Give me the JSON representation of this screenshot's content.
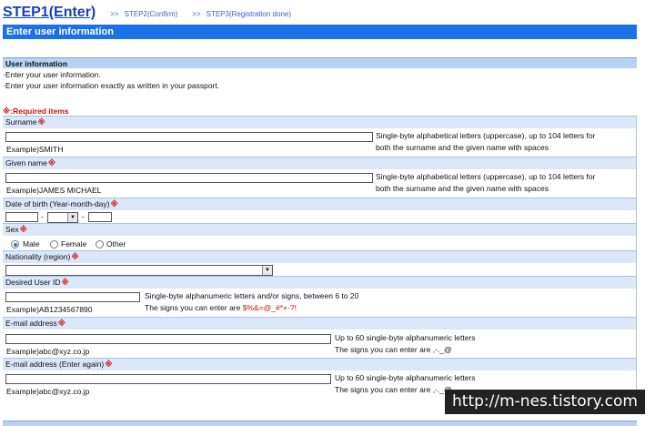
{
  "steps": {
    "step1": "STEP1(Enter)",
    "sep1": ">>",
    "step2": "STEP2(Confirm)",
    "sep2": ">>",
    "step3": "STEP3(Registration done)"
  },
  "header": {
    "title": "Enter user information"
  },
  "section": {
    "title": "User information",
    "notes": [
      "·Enter your user information.",
      "·Enter your user information exactly as written in your passport."
    ]
  },
  "required_label": "※:Required items",
  "required_mark": "※",
  "fields": {
    "surname": {
      "label": "Surname",
      "value": "",
      "example": "Example)SMITH",
      "hint1": "Single-byte alphabetical letters (uppercase), up to 104 letters for",
      "hint2": "both the surname and the given name with spaces"
    },
    "given_name": {
      "label": "Given name",
      "value": "",
      "example": "Example)JAMES MICHAEL",
      "hint1": "Single-byte alphabetical letters (uppercase), up to 104 letters for",
      "hint2": "both the surname and the given name with spaces"
    },
    "dob": {
      "label": "Date of birth (Year-month-day)",
      "year": "",
      "month": "",
      "day": "",
      "dash": "-"
    },
    "sex": {
      "label": "Sex",
      "options": [
        "Male",
        "Female",
        "Other"
      ],
      "selected": "Male"
    },
    "nationality": {
      "label": "Nationality (region)",
      "value": ""
    },
    "user_id": {
      "label": "Desired User ID",
      "value": "",
      "example": "Example)AB1234567890",
      "hint1": "Single-byte alphanumeric letters and/or signs, between 6 to 20",
      "hint2_prefix": "The signs you can enter are ",
      "hint2_signs": "$%&=@_#*+-?!"
    },
    "email": {
      "label": "E-mail address",
      "value": "",
      "example": "Example)abc@xyz.co.jp",
      "hint1": "Up to 60 single-byte alphanumeric letters",
      "hint2": "The signs you can enter are ,-._@"
    },
    "email2": {
      "label": "E-mail address (Enter again)",
      "value": "",
      "example": "Example)abc@xyz.co.jp",
      "hint1": "Up to 60 single-byte alphanumeric letters",
      "hint2": "The signs you can enter are ,-._@"
    }
  },
  "watermark": "http://m-nes.tistory.com",
  "colors": {
    "accent": "#1a72e6",
    "label_bg": "#dbe7f7",
    "required": "#cc1111",
    "step_link": "#1a3fb8"
  }
}
